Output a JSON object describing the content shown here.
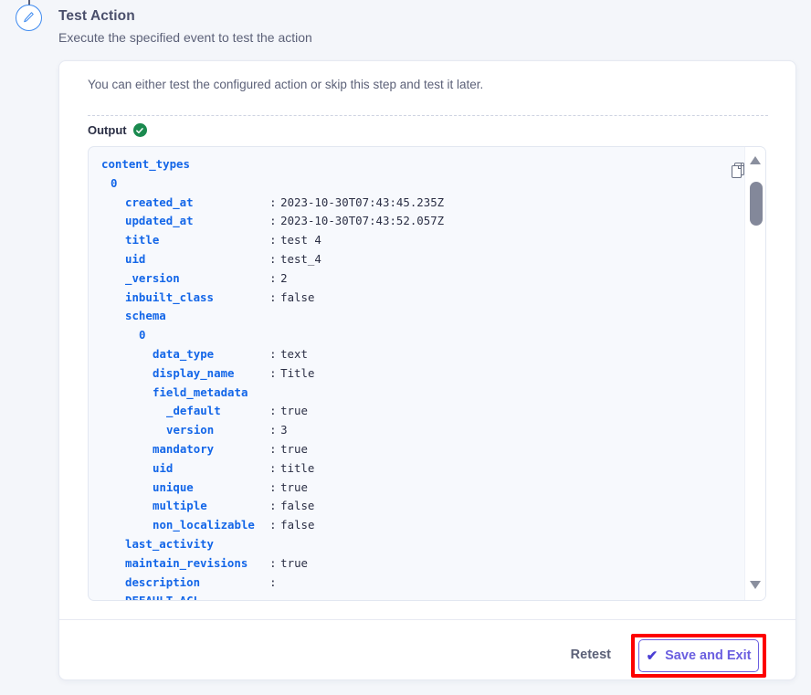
{
  "header": {
    "title": "Test Action",
    "subtitle": "Execute the specified event to test the action",
    "step_icon": "pencil-icon"
  },
  "card": {
    "hint": "You can either test the configured action or skip this step and test it later.",
    "output_label": "Output",
    "status_icon": "check-circle-icon",
    "copy_icon": "copy-icon"
  },
  "output": {
    "rows": [
      {
        "level": 0,
        "key": "content_types",
        "sep": "",
        "value": ""
      },
      {
        "level": 1,
        "key": "0",
        "sep": "",
        "value": ""
      },
      {
        "level": 2,
        "key": "created_at",
        "sep": ":",
        "value": "2023-10-30T07:43:45.235Z"
      },
      {
        "level": 2,
        "key": "updated_at",
        "sep": ":",
        "value": "2023-10-30T07:43:52.057Z"
      },
      {
        "level": 2,
        "key": "title",
        "sep": ":",
        "value": "test 4"
      },
      {
        "level": 2,
        "key": "uid",
        "sep": ":",
        "value": "test_4"
      },
      {
        "level": 2,
        "key": "_version",
        "sep": ":",
        "value": "2"
      },
      {
        "level": 2,
        "key": "inbuilt_class",
        "sep": ":",
        "value": "false"
      },
      {
        "level": 2,
        "key": "schema",
        "sep": "",
        "value": ""
      },
      {
        "level": 3,
        "key": "0",
        "sep": "",
        "value": ""
      },
      {
        "level": 4,
        "key": "data_type",
        "sep": ":",
        "value": "text"
      },
      {
        "level": 4,
        "key": "display_name",
        "sep": ":",
        "value": "Title"
      },
      {
        "level": 4,
        "key": "field_metadata",
        "sep": "",
        "value": ""
      },
      {
        "level": 5,
        "key": "_default",
        "sep": ":",
        "value": "true"
      },
      {
        "level": 5,
        "key": "version",
        "sep": ":",
        "value": "3"
      },
      {
        "level": 4,
        "key": "mandatory",
        "sep": ":",
        "value": "true"
      },
      {
        "level": 4,
        "key": "uid",
        "sep": ":",
        "value": "title"
      },
      {
        "level": 4,
        "key": "unique",
        "sep": ":",
        "value": "true"
      },
      {
        "level": 4,
        "key": "multiple",
        "sep": ":",
        "value": "false"
      },
      {
        "level": 4,
        "key": "non_localizable",
        "sep": ":",
        "value": "false"
      },
      {
        "level": 2,
        "key": "last_activity",
        "sep": "",
        "value": ""
      },
      {
        "level": 2,
        "key": "maintain_revisions",
        "sep": ":",
        "value": "true"
      },
      {
        "level": 2,
        "key": "description",
        "sep": ":",
        "value": ""
      },
      {
        "level": 2,
        "key": "DEFAULT_ACL",
        "sep": "",
        "value": ""
      }
    ],
    "scrollbar": {
      "up_icon": "triangle-up-icon",
      "down_icon": "triangle-down-icon"
    }
  },
  "footer": {
    "retest_label": "Retest",
    "save_exit_label": "Save and Exit",
    "save_exit_check": "✔"
  },
  "colors": {
    "page_background": "#f4f6fa",
    "card_background": "#ffffff",
    "key_blue": "#1366e8",
    "accent_purple": "#6b5fe0",
    "success_green": "#1a8a4f",
    "highlight_red": "#fd0000",
    "text_dark": "#2b2f45",
    "text_muted": "#5c6178"
  }
}
